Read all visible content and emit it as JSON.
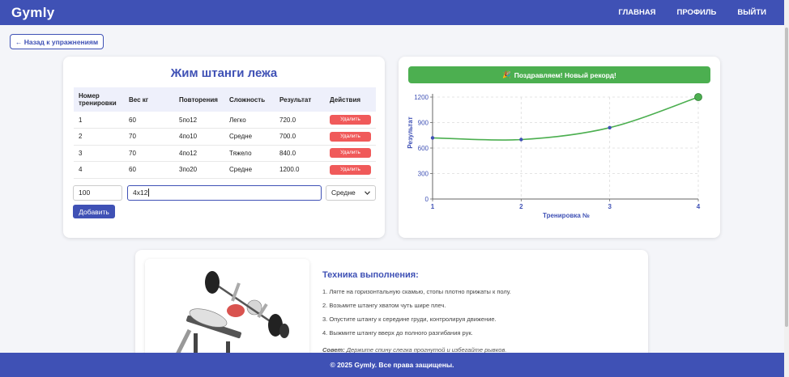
{
  "nav": {
    "brand": "Gymly",
    "links": [
      "ГЛАВНАЯ",
      "ПРОФИЛЬ",
      "ВЫЙТИ"
    ]
  },
  "back_label": "← Назад к упражнениям",
  "exercise": {
    "title": "Жим штанги лежа",
    "columns": [
      "Номер тренировки",
      "Вес кг",
      "Повторения",
      "Сложность",
      "Результат",
      "Действия"
    ],
    "rows": [
      [
        "1",
        "60",
        "5по12",
        "Легко",
        "720.0",
        "Удалить"
      ],
      [
        "2",
        "70",
        "4по10",
        "Средне",
        "700.0",
        "Удалить"
      ],
      [
        "3",
        "70",
        "4по12",
        "Тяжело",
        "840.0",
        "Удалить"
      ],
      [
        "4",
        "60",
        "3по20",
        "Средне",
        "1200.0",
        "Удалить"
      ]
    ],
    "form": {
      "weight": "100",
      "reps": "4x12",
      "difficulty": "Средне",
      "add_label": "Добавить"
    }
  },
  "record_banner": "Поздравляем! Новый рекорд!",
  "record_icon": "party-popper-icon",
  "chart_data": {
    "type": "line",
    "x": [
      1,
      2,
      3,
      4
    ],
    "values": [
      720,
      700,
      840,
      1200
    ],
    "xlabel": "Тренировка №",
    "ylabel": "Результат",
    "ylim": [
      0,
      1200
    ],
    "yticks": [
      0,
      300,
      600,
      900,
      1200
    ],
    "color": "#4caf50",
    "point_color": "#3f51b5",
    "grid": true
  },
  "technique": {
    "title": "Техника выполнения:",
    "steps": [
      "1. Лягте на горизонтальную скамью, стопы плотно прижаты к полу.",
      "2. Возьмите штангу хватом чуть шире плеч.",
      "3. Опустите штангу к середине груди, контролируя движение.",
      "4. Выжмите штангу вверх до полного разгибания рук."
    ],
    "tip_label": "Совет:",
    "tip": "Держите спину слегка прогнутой и избегайте рывков."
  },
  "footer": "© 2025 Gymly. Все права защищены.",
  "colors": {
    "primary": "#3f51b5",
    "success": "#4caf50",
    "danger": "#f05a5a"
  }
}
